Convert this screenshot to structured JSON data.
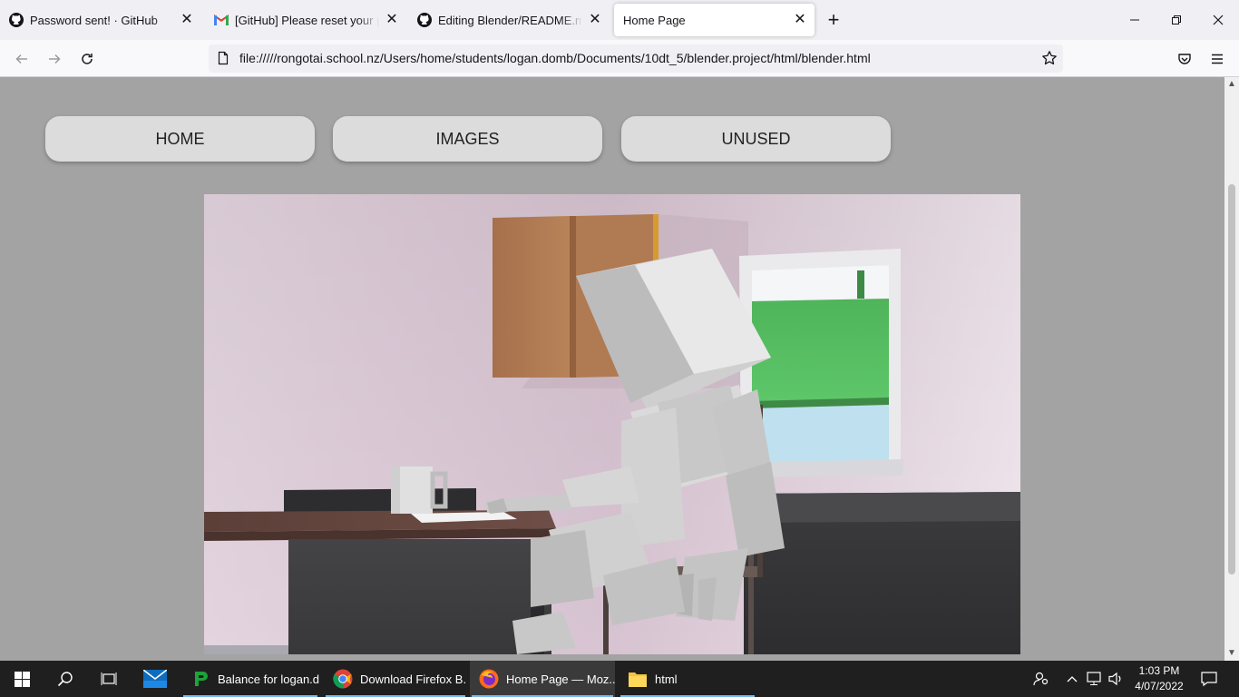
{
  "browser": {
    "tabs": [
      {
        "title": "Password sent! · GitHub",
        "icon": "github-icon",
        "active": false
      },
      {
        "title": "[GitHub] Please reset your password",
        "icon": "gmail-icon",
        "active": false
      },
      {
        "title": "Editing Blender/README.md at main",
        "icon": "github-icon",
        "active": false
      },
      {
        "title": "Home Page",
        "icon": "none",
        "active": true
      }
    ],
    "url": "file://///rongotai.school.nz/Users/home/students/logan.domb/Documents/10dt_5/blender.project/html/blender.html"
  },
  "page": {
    "nav": [
      "HOME",
      "IMAGES",
      "UNUSED"
    ],
    "background_color": "#a3a3a3",
    "button_color": "#dcdcdc"
  },
  "taskbar": {
    "apps": [
      {
        "label": "Balance for logan.d...",
        "icon": "app-green-icon"
      },
      {
        "label": "Download Firefox B...",
        "icon": "chrome-icon"
      },
      {
        "label": "Home Page — Moz...",
        "icon": "firefox-icon",
        "active": true
      },
      {
        "label": "html",
        "icon": "folder-icon"
      }
    ],
    "time": "1:03 PM",
    "date": "4/07/2022"
  }
}
